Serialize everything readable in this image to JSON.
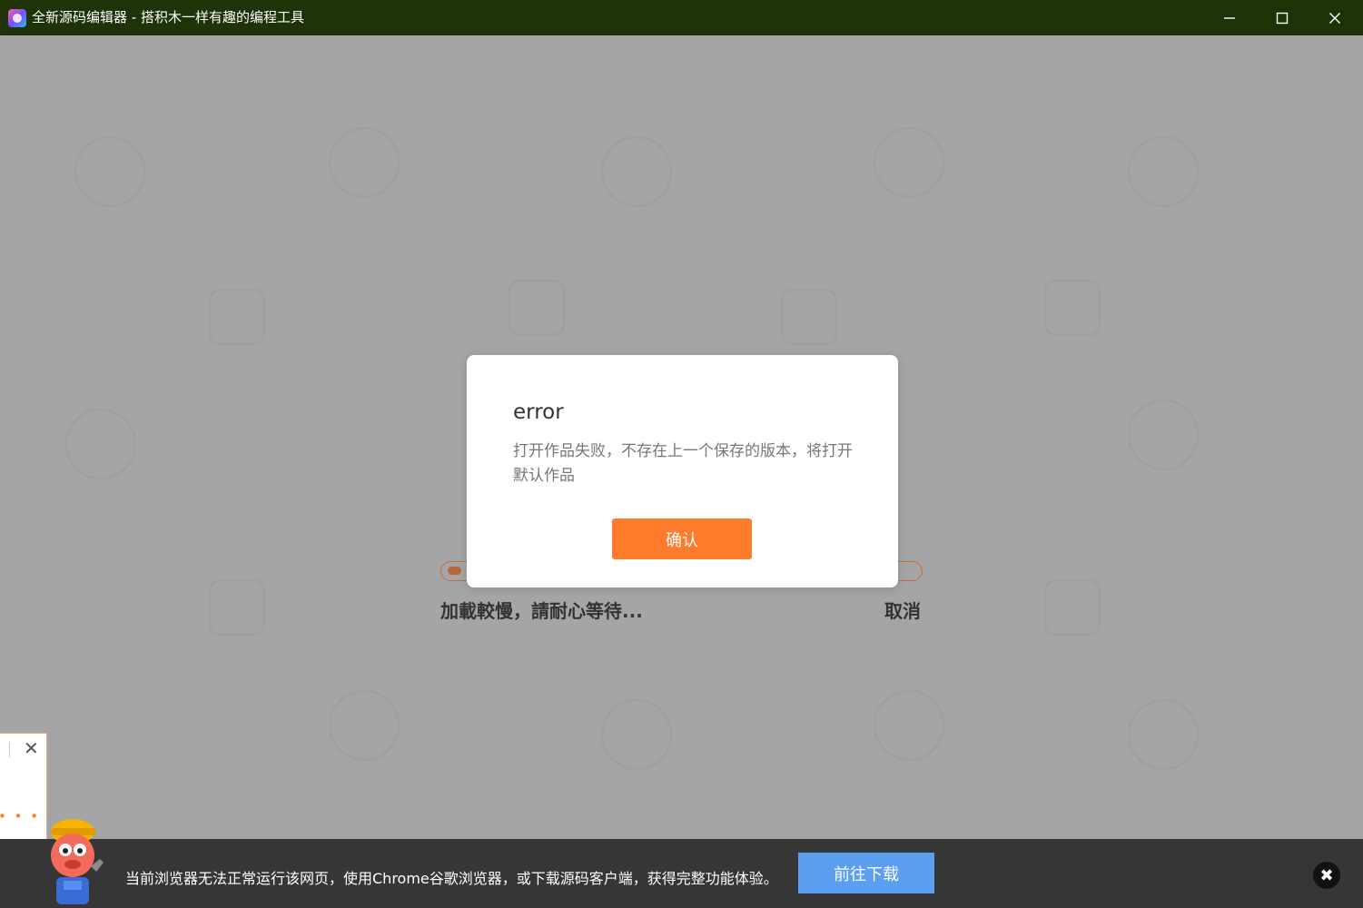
{
  "window": {
    "title": "全新源码编辑器 - 搭积木一样有趣的编程工具"
  },
  "loader": {
    "text": "加載較慢，請耐心等待...",
    "cancel_label": "取消",
    "progress": 0.03
  },
  "dialog": {
    "title": "error",
    "message": "打开作品失败，不存在上一个保存的版本，将打开默认作品",
    "confirm_label": "确认"
  },
  "side_popup": {
    "close_glyph": "✕",
    "dots": "• • •"
  },
  "banner": {
    "message": "当前浏览器无法正常运行该网页，使用Chrome谷歌浏览器，或下载源码客户端，获得完整功能体验。",
    "download_label": "前往下载",
    "close_glyph": "✖"
  },
  "colors": {
    "titlebar": "#1f3309",
    "accent_orange": "#ff7b2c",
    "download_blue": "#5b9ff0",
    "banner_bg": "#363636",
    "overlay_gray": "#a5a5a7"
  }
}
